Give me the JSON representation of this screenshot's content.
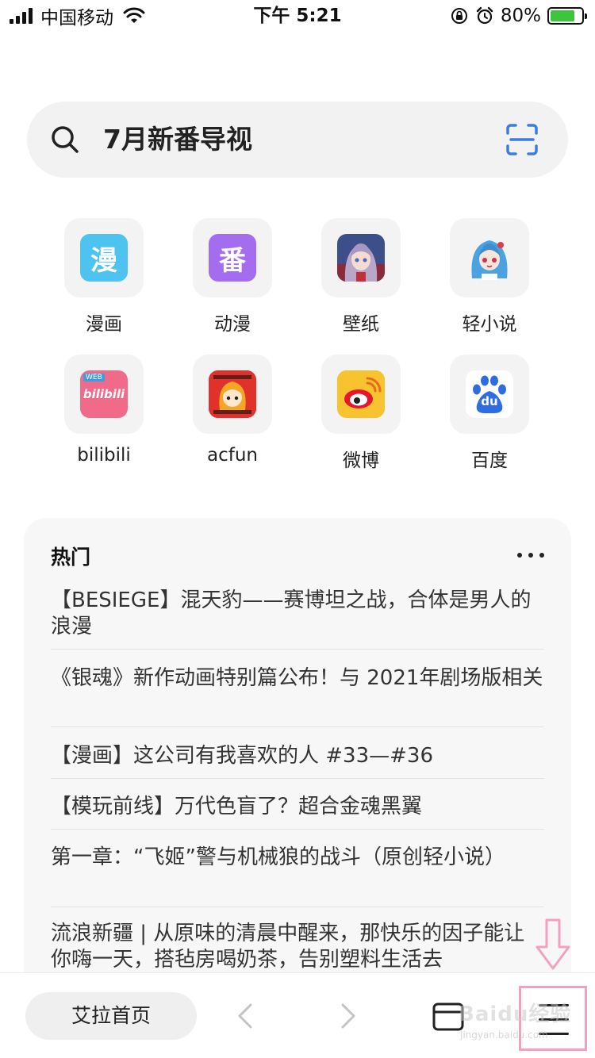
{
  "status_bar": {
    "carrier": "中国移动",
    "time": "下午 5:21",
    "battery_percent": "80%",
    "battery_level": 0.8,
    "battery_color": "#3dc53d",
    "icons": [
      "signal-icon",
      "wifi-icon",
      "orientation-lock-icon",
      "alarm-icon",
      "battery-icon"
    ]
  },
  "search": {
    "text": "7月新番导视",
    "icon": "search-icon",
    "scan_icon": "scan-icon",
    "scan_color": "#3b7ddd"
  },
  "shortcuts": [
    {
      "label": "漫画",
      "glyph": "漫",
      "color": "#4fc3f0"
    },
    {
      "label": "动漫",
      "glyph": "番",
      "color": "#a46df0"
    },
    {
      "label": "壁纸",
      "icon": "anime-girl-wallpaper-icon"
    },
    {
      "label": "轻小说",
      "icon": "anime-girl-novel-icon"
    },
    {
      "label": "bilibili",
      "logo_text": "bilibili",
      "badge": "WEB",
      "color": "#f06a8a"
    },
    {
      "label": "acfun",
      "icon": "acfun-logo-icon",
      "color": "#e0322a"
    },
    {
      "label": "微博",
      "icon": "weibo-logo-icon",
      "color": "#f7c42f"
    },
    {
      "label": "百度",
      "logo_text": "du",
      "color": "#2f6ce0"
    }
  ],
  "hot": {
    "title": "热门",
    "items": [
      {
        "text": "【BESIEGE】混天豹——赛博坦之战，合体是男人的浪漫"
      },
      {
        "text": "《银魂》新作动画特别篇公布！与 2021年剧场版相关"
      },
      {
        "text": "【漫画】这公司有我喜欢的人 #33—#36"
      },
      {
        "text": "【模玩前线】万代色盲了？超合金魂黑翼"
      },
      {
        "text": "第一章：“飞姬”警与机械狼的战斗（原创轻小说）"
      },
      {
        "text": "流浪新疆 | 从原味的清晨中醒来，那快乐的因子能让你嗨一天，搭毡房喝奶茶，告别塑料生活去"
      }
    ]
  },
  "bottom_bar": {
    "home_label": "艾拉首页",
    "icons": [
      "back-arrow-icon",
      "forward-arrow-icon",
      "tabs-icon",
      "menu-icon"
    ],
    "highlight_color": "#f2a1c2"
  },
  "watermark": {
    "text": "Baidu经验",
    "sub": "jingyan.baidu.com"
  }
}
